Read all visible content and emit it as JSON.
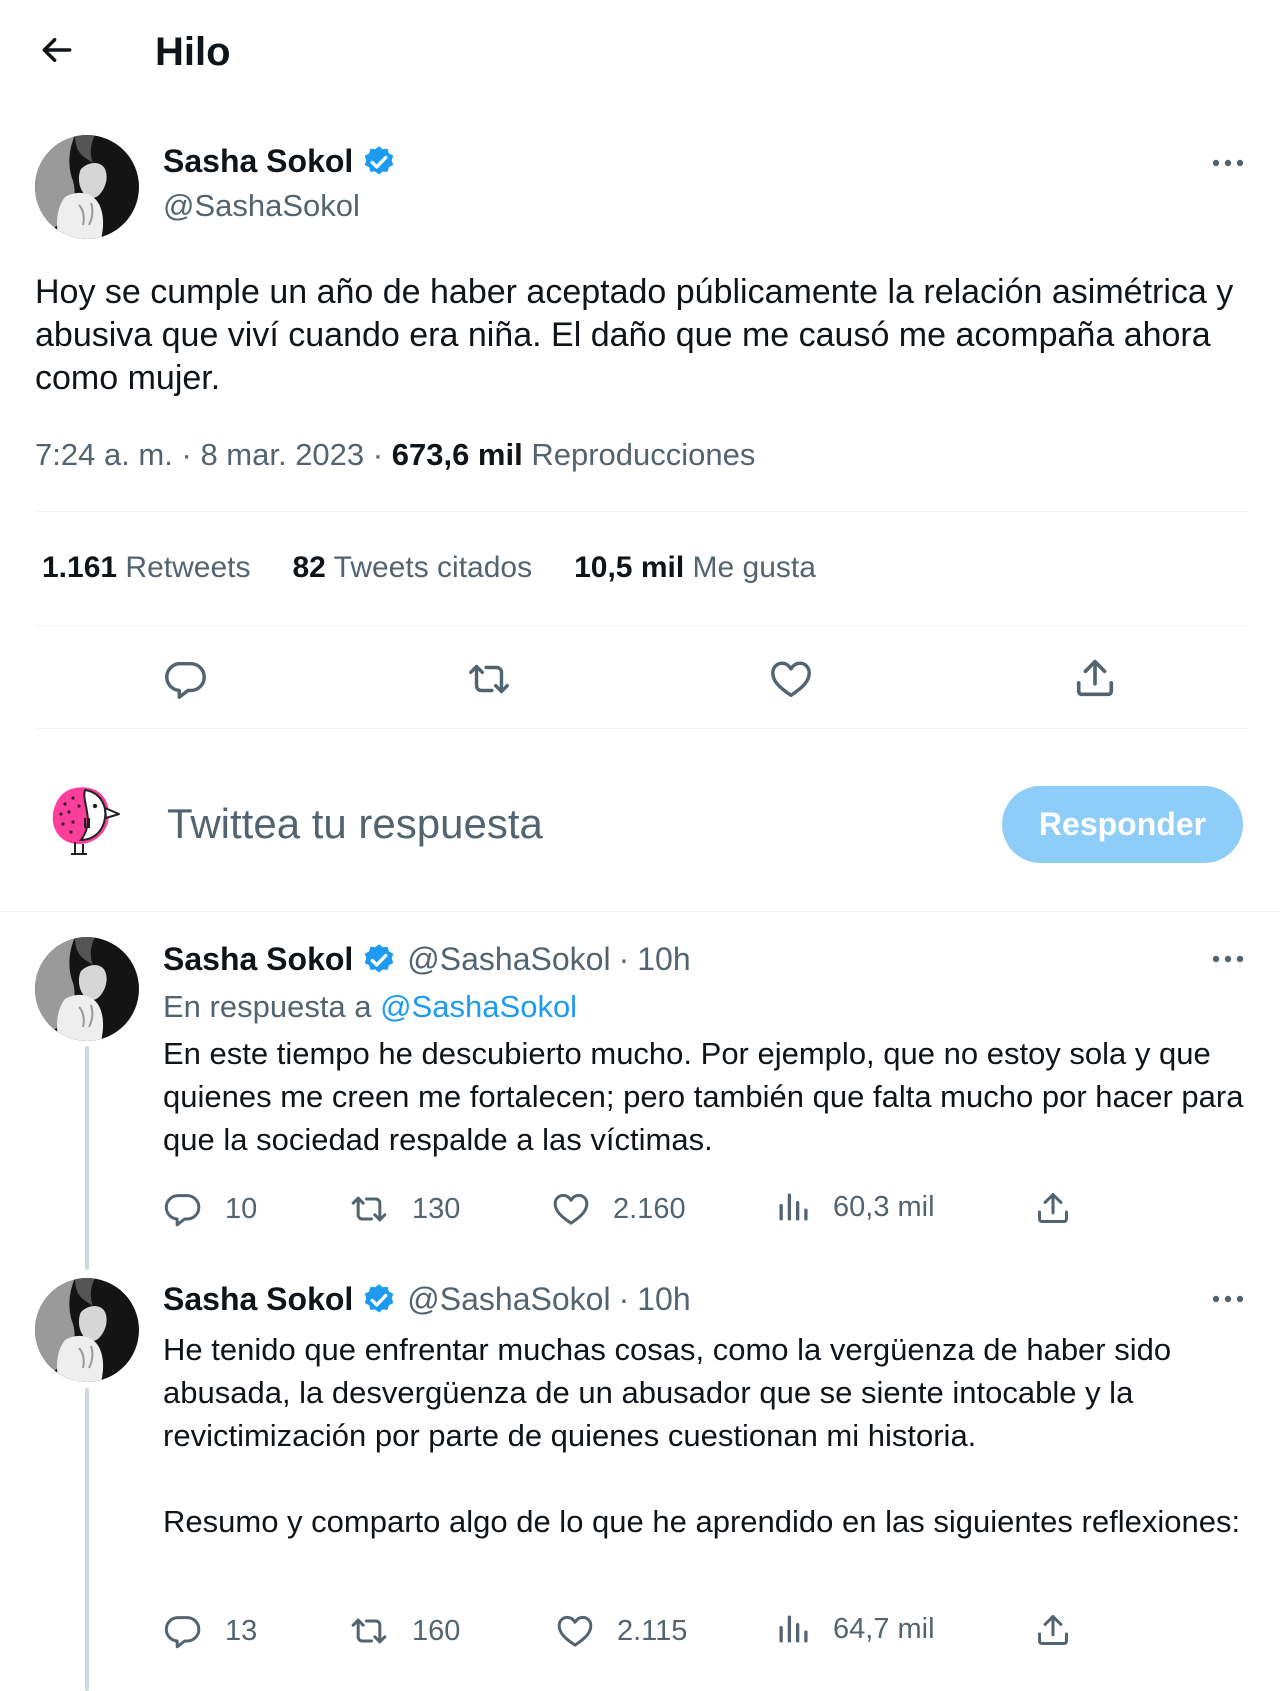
{
  "header": {
    "title": "Hilo"
  },
  "main_tweet": {
    "author_name": "Sasha Sokol",
    "author_handle": "@SashaSokol",
    "text": "Hoy se cumple un año de haber aceptado públicamente la relación asimétrica y abusiva que viví cuando era niña. El daño que me causó me acompaña ahora como mujer.",
    "time": "7:24 a. m.",
    "sep1": "·",
    "date": "8 mar. 2023",
    "sep2": "·",
    "views_count": "673,6 mil",
    "views_label": "Reproducciones",
    "retweets_count": "1.161",
    "retweets_label": "Retweets",
    "quotes_count": "82",
    "quotes_label": "Tweets citados",
    "likes_count": "10,5 mil",
    "likes_label": "Me gusta"
  },
  "reply_box": {
    "placeholder": "Twittea tu respuesta",
    "button_label": "Responder"
  },
  "replies": [
    {
      "author_name": "Sasha Sokol",
      "author_handle": "@SashaSokol",
      "sep": "·",
      "time": "10h",
      "reply_to_prefix": "En respuesta a",
      "reply_to_handle": "@SashaSokol",
      "text": "En este tiempo he descubierto mucho. Por ejemplo, que no estoy sola y que quienes me creen me fortalecen; pero también que falta mucho por hacer para que la sociedad respalde a las víctimas.",
      "replies": "10",
      "retweets": "130",
      "likes": "2.160",
      "views": "60,3 mil"
    },
    {
      "author_name": "Sasha Sokol",
      "author_handle": "@SashaSokol",
      "sep": "·",
      "time": "10h",
      "text_p1": "He tenido que enfrentar muchas cosas, como la vergüenza de haber sido abusada, la desvergüenza de un abusador que se siente intocable y la revictimización por parte de quienes cuestionan mi historia.",
      "text_p2": "Resumo y comparto algo de lo que he aprendido en las siguientes reflexiones:",
      "replies": "13",
      "retweets": "160",
      "likes": "2.115",
      "views": "64,7 mil"
    }
  ],
  "colors": {
    "accent": "#1d9bf0",
    "button_disabled": "#8ecdf8",
    "muted": "#536471",
    "divider": "#eff3f4"
  },
  "icons": [
    "back-arrow-icon",
    "verified-badge-icon",
    "more-icon",
    "reply-icon",
    "retweet-icon",
    "like-icon",
    "share-icon",
    "views-icon"
  ]
}
